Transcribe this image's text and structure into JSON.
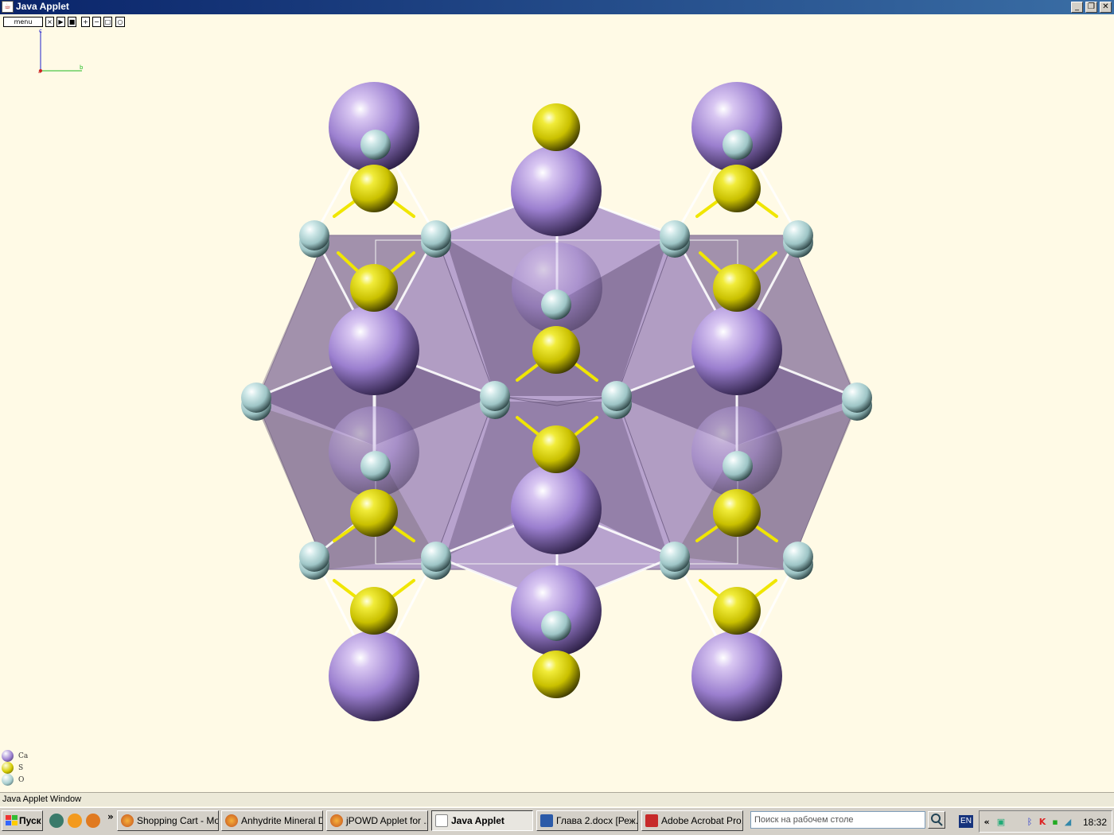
{
  "window": {
    "title": "Java Applet",
    "controls": {
      "minimize": "_",
      "maximize": "❐",
      "close": "✕"
    }
  },
  "toolbar": {
    "menu_label": "menu",
    "buttons": [
      "close-view-icon",
      "play-icon",
      "stop-icon",
      "zoom-in-icon",
      "zoom-out-icon",
      "fit-icon",
      "reset-icon"
    ]
  },
  "axes": {
    "vertical_label": "c",
    "horizontal_label": "b",
    "origin_label": "a",
    "colors": {
      "c": "#2222cc",
      "b": "#22bb22",
      "a": "#cc2222"
    }
  },
  "legend": [
    {
      "label": "Ca",
      "color": "#9b7fcf"
    },
    {
      "label": "S",
      "color": "#d4cc00"
    },
    {
      "label": "O",
      "color": "#a9cfd0"
    }
  ],
  "colors": {
    "calcium": "#9b7fcf",
    "sulfur": "#d4cc00",
    "oxygen": "#b3d7d8",
    "background": "#fffae6",
    "polyhedron": "#8a6fa8"
  },
  "status": {
    "text": "Java Applet Window"
  },
  "taskbar": {
    "start_label": "Пуск",
    "quick_launch_chevron": "»",
    "tasks": [
      {
        "label": "Shopping Cart - Mo...",
        "icon": "firefox-icon",
        "active": false
      },
      {
        "label": "Anhydrite Mineral D...",
        "icon": "firefox-icon",
        "active": false
      },
      {
        "label": "jPOWD Applet for ...",
        "icon": "firefox-icon",
        "active": false
      },
      {
        "label": "Java Applet",
        "icon": "java-icon",
        "active": true
      },
      {
        "label": "Глава 2.docx [Реж...",
        "icon": "word-icon",
        "active": false
      },
      {
        "label": "Adobe Acrobat Pro...",
        "icon": "acrobat-icon",
        "active": false
      }
    ],
    "search_placeholder": "Поиск на рабочем столе",
    "language": "EN",
    "tray_chevron": "«",
    "clock": "18:32"
  }
}
